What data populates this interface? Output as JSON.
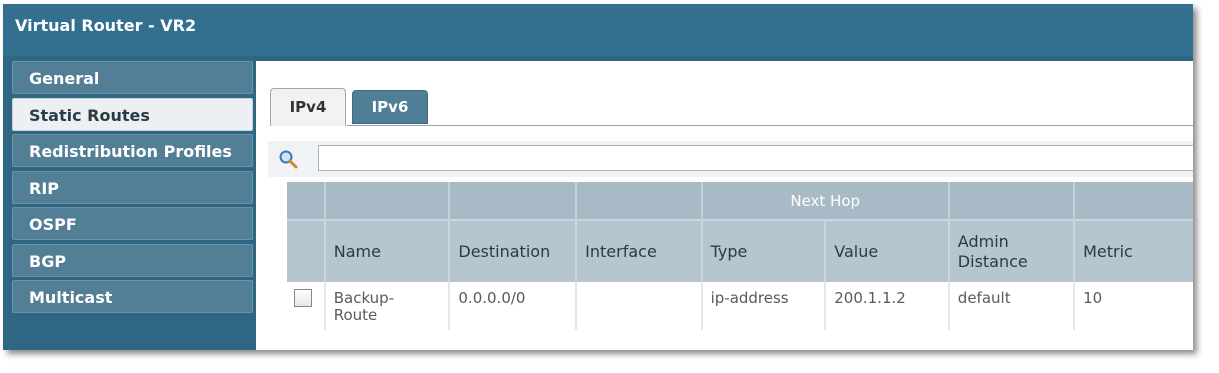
{
  "window": {
    "title": "Virtual Router - VR2"
  },
  "sidebar": {
    "items": [
      {
        "label": "General",
        "active": false
      },
      {
        "label": "Static Routes",
        "active": true
      },
      {
        "label": "Redistribution Profiles",
        "active": false
      },
      {
        "label": "RIP",
        "active": false
      },
      {
        "label": "OSPF",
        "active": false
      },
      {
        "label": "BGP",
        "active": false
      },
      {
        "label": "Multicast",
        "active": false
      }
    ]
  },
  "tabs": [
    {
      "label": "IPv4",
      "active": true
    },
    {
      "label": "IPv6",
      "active": false
    }
  ],
  "search": {
    "value": "",
    "icon": "search-icon"
  },
  "table": {
    "group_header": "Next Hop",
    "columns": {
      "name": "Name",
      "destination": "Destination",
      "interface": "Interface",
      "type": "Type",
      "value": "Value",
      "admin_distance_line1": "Admin",
      "admin_distance_line2": "Distance",
      "metric": "Metric"
    },
    "rows": [
      {
        "checked": false,
        "name_line1": "Backup-",
        "name_line2": "Route",
        "destination": "0.0.0.0/0",
        "interface": "",
        "type": "ip-address",
        "value": "200.1.1.2",
        "admin_distance": "default",
        "metric": "10"
      }
    ]
  },
  "colors": {
    "titlebar": "#33708f",
    "sidebar": "#2e6683",
    "header": "#b5c6d1"
  }
}
